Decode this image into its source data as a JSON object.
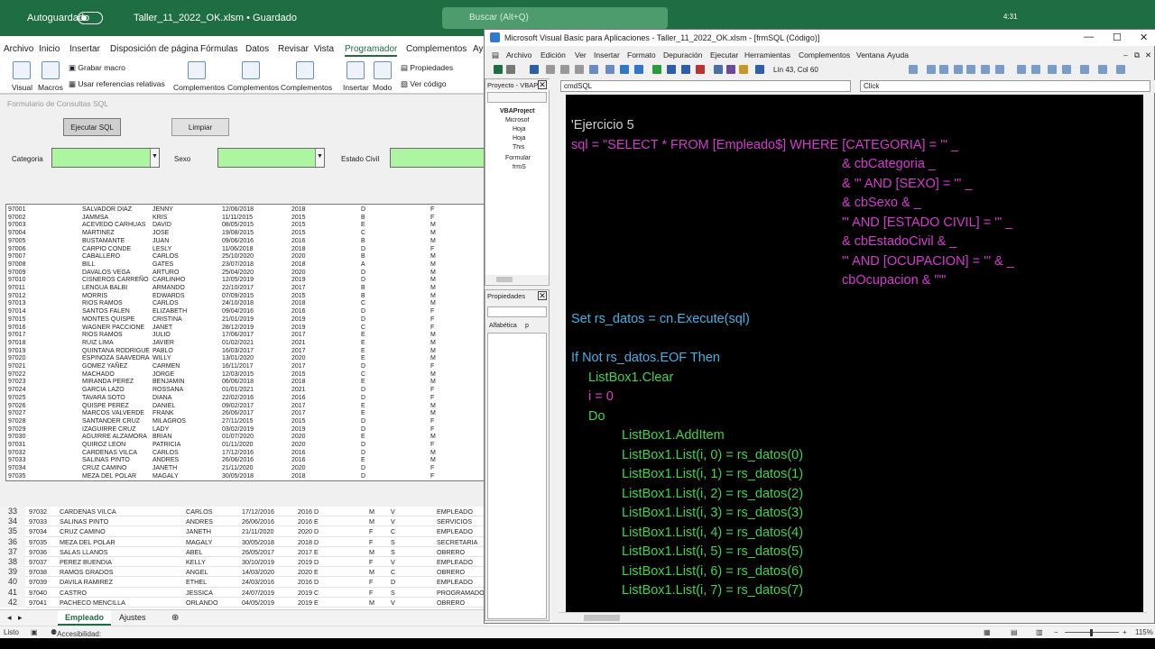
{
  "excel": {
    "autosave_label": "Autoguardado",
    "file_title": "Taller_11_2022_OK.xlsm • Guardado",
    "search_placeholder": "Buscar (Alt+Q)",
    "menu": [
      "Archivo",
      "Inicio",
      "Insertar",
      "Disposición de página",
      "Fórmulas",
      "Datos",
      "Revisar",
      "Vista",
      "Programador",
      "Complementos",
      "Ay"
    ],
    "ribbon": {
      "visual": "Visual",
      "macros": "Macros",
      "grabar": "Grabar macro",
      "refs": "Usar referencias relativas",
      "comp1": "Complementos",
      "comp2": "Complementos",
      "comp3": "Complementos",
      "insertar": "Insertar",
      "modo": "Modo",
      "propiedades": "Propiedades",
      "vercodigo": "Ver código"
    },
    "form": {
      "title": "Formulario de Consultas SQL",
      "btn_execute": "Ejecutar SQL",
      "btn_clear": "Limpiar",
      "label_categoria": "Categoria",
      "label_sexo": "Sexo",
      "label_estado": "Estado Civil",
      "rows": [
        [
          "97001",
          "SALVADOR DIAZ",
          "JENNY",
          "12/06/2018",
          "2018",
          "D",
          "F"
        ],
        [
          "97002",
          "JAMMSA",
          "KRIS",
          "11/11/2015",
          "2015",
          "B",
          "F"
        ],
        [
          "97003",
          "ACEVEDO CARHUAS",
          "DAVID",
          "08/05/2015",
          "2015",
          "E",
          "M"
        ],
        [
          "97004",
          "MARTINEZ",
          "JOSE",
          "19/08/2015",
          "2015",
          "C",
          "M"
        ],
        [
          "97005",
          "BUSTAMANTE",
          "JUAN",
          "09/06/2016",
          "2016",
          "B",
          "M"
        ],
        [
          "97006",
          "CARPIO CONDE",
          "LESLY",
          "11/06/2018",
          "2018",
          "D",
          "F"
        ],
        [
          "97007",
          "CABALLERO",
          "CARLOS",
          "25/10/2020",
          "2020",
          "B",
          "M"
        ],
        [
          "97008",
          "BILL",
          "GATES",
          "23/07/2018",
          "2018",
          "A",
          "M"
        ],
        [
          "97009",
          "DAVALOS VEGA",
          "ARTURO",
          "25/04/2020",
          "2020",
          "D",
          "M"
        ],
        [
          "97010",
          "CISNEROS CARREÑO",
          "CARLINHO",
          "12/05/2019",
          "2019",
          "D",
          "M"
        ],
        [
          "97011",
          "LENGUA BALBI",
          "ARMANDO",
          "22/10/2017",
          "2017",
          "B",
          "M"
        ],
        [
          "97012",
          "MORRIS",
          "EDWARDS",
          "07/09/2015",
          "2015",
          "B",
          "M"
        ],
        [
          "97013",
          "RIOS RAMOS",
          "CARLOS",
          "24/10/2018",
          "2018",
          "C",
          "M"
        ],
        [
          "97014",
          "SANTOS FALEN",
          "ELIZABETH",
          "09/04/2016",
          "2016",
          "D",
          "F"
        ],
        [
          "97015",
          "MONTES QUISPE",
          "CRISTINA",
          "21/01/2019",
          "2019",
          "D",
          "F"
        ],
        [
          "97016",
          "WAGNER PACCIONE",
          "JANET",
          "28/12/2019",
          "2019",
          "C",
          "F"
        ],
        [
          "97017",
          "RIOS RAMOS",
          "JULIO",
          "17/06/2017",
          "2017",
          "E",
          "M"
        ],
        [
          "97018",
          "RUIZ LIMA",
          "JAVIER",
          "01/02/2021",
          "2021",
          "E",
          "M"
        ],
        [
          "97019",
          "QUINTANA RODRIGUE",
          "PABLO",
          "16/03/2017",
          "2017",
          "E",
          "M"
        ],
        [
          "97020",
          "ESPINOZA SAAVEDRA",
          "WILLY",
          "13/01/2020",
          "2020",
          "E",
          "M"
        ],
        [
          "97021",
          "GOMEZ YAÑEZ",
          "CARMEN",
          "16/11/2017",
          "2017",
          "D",
          "F"
        ],
        [
          "97022",
          "MACHADO",
          "JORGE",
          "12/03/2015",
          "2015",
          "C",
          "M"
        ],
        [
          "97023",
          "MIRANDA PEREZ",
          "BENJAMIN",
          "06/06/2018",
          "2018",
          "E",
          "M"
        ],
        [
          "97024",
          "GARCIA LAZO",
          "ROSSANA",
          "01/01/2021",
          "2021",
          "D",
          "F"
        ],
        [
          "97025",
          "TAVARA SOTO",
          "DIANA",
          "22/02/2016",
          "2016",
          "D",
          "F"
        ],
        [
          "97026",
          "QUISPE PEREZ",
          "DANIEL",
          "09/02/2017",
          "2017",
          "E",
          "M"
        ],
        [
          "97027",
          "MARCOS VALVERDE",
          "FRANK",
          "26/06/2017",
          "2017",
          "E",
          "M"
        ],
        [
          "97028",
          "SANTANDER CRUZ",
          "MILAGROS",
          "27/11/2015",
          "2015",
          "D",
          "F"
        ],
        [
          "97029",
          "IZAGUIRRE CRUZ",
          "LADY",
          "03/02/2019",
          "2019",
          "D",
          "F"
        ],
        [
          "97030",
          "AGUIRRE ALZAMORA",
          "BRIAN",
          "01/07/2020",
          "2020",
          "E",
          "M"
        ],
        [
          "97031",
          "QUIROZ LEON",
          "PATRICIA",
          "01/11/2020",
          "2020",
          "D",
          "F"
        ],
        [
          "97032",
          "CARDENAS VILCA",
          "CARLOS",
          "17/12/2016",
          "2016",
          "D",
          "M"
        ],
        [
          "97033",
          "SALINAS PINTO",
          "ANDRES",
          "26/06/2016",
          "2016",
          "E",
          "M"
        ],
        [
          "97034",
          "CRUZ CAMINO",
          "JANETH",
          "21/11/2020",
          "2020",
          "D",
          "F"
        ],
        [
          "97035",
          "MEZA DEL POLAR",
          "MAGALY",
          "30/05/2018",
          "2018",
          "D",
          "F"
        ]
      ]
    },
    "sheet_rows": [
      [
        "33",
        "97032",
        "CARDENAS VILCA",
        "CARLOS",
        "17/12/2016",
        "2016 D",
        "M",
        "V",
        "EMPLEADO"
      ],
      [
        "34",
        "97033",
        "SALINAS PINTO",
        "ANDRES",
        "26/06/2016",
        "2016 E",
        "M",
        "V",
        "SERVICIOS"
      ],
      [
        "35",
        "97034",
        "CRUZ CAMINO",
        "JANETH",
        "21/11/2020",
        "2020 D",
        "F",
        "C",
        "EMPLEADO"
      ],
      [
        "36",
        "97035",
        "MEZA DEL POLAR",
        "MAGALY",
        "30/05/2018",
        "2018 D",
        "F",
        "S",
        "SECRETARIA"
      ],
      [
        "37",
        "97036",
        "SALAS LLANOS",
        "ABEL",
        "26/05/2017",
        "2017 E",
        "M",
        "S",
        "OBRERO"
      ],
      [
        "38",
        "97037",
        "PEREZ BUENDIA",
        "KELLY",
        "30/10/2019",
        "2019 D",
        "F",
        "V",
        "EMPLEADO"
      ],
      [
        "39",
        "97038",
        "RAMOS GRADOS",
        "ANGEL",
        "14/03/2020",
        "2020 E",
        "M",
        "C",
        "OBRERO"
      ],
      [
        "40",
        "97039",
        "DAVILA RAMIREZ",
        "ETHEL",
        "24/03/2016",
        "2016 D",
        "F",
        "D",
        "EMPLEADO"
      ],
      [
        "41",
        "97040",
        "CASTRO",
        "JESSICA",
        "24/07/2019",
        "2019 C",
        "F",
        "S",
        "PROGRAMADO"
      ],
      [
        "42",
        "97041",
        "PACHECO MENCILLA",
        "ORLANDO",
        "04/05/2019",
        "2019 E",
        "M",
        "V",
        "OBRERO"
      ]
    ],
    "tabs": [
      "Empleado",
      "Ajustes"
    ],
    "status_listo": "Listo",
    "status_access": "Accesibilidad: todo correcto",
    "zoom": "115%",
    "clock": "4:31"
  },
  "vbe": {
    "title": "Microsoft Visual Basic para Aplicaciones - Taller_11_2022_OK.xlsm - [frmSQL (Código)]",
    "menu": [
      "Archivo",
      "Edición",
      "Ver",
      "Insertar",
      "Formato",
      "Depuración",
      "Ejecutar",
      "Herramientas",
      "Complementos",
      "Ventana",
      "Ayuda"
    ],
    "position": "Lín 43, Col 60",
    "project_title": "Proyecto - VBAP",
    "tree": [
      "VBAProject",
      "Microsof",
      "Hoja",
      "Hoja",
      "This",
      "Formular",
      "frmS"
    ],
    "props_title": "Propiedades",
    "props_tabs": [
      "Alfabética",
      "p"
    ],
    "object_dd": "cmdSQL",
    "proc_dd": "Click",
    "code": [
      {
        "cls": "c-com",
        "text": "'Ejercicio 5"
      },
      {
        "cls": "c-str",
        "text": "sql = \"SELECT * FROM [Empleado$] WHERE [CATEGORIA] = '\" _"
      },
      {
        "cls": "c-str",
        "text": "& cbCategoria _",
        "indent": 1
      },
      {
        "cls": "c-str",
        "text": "& \"' AND [SEXO] = '\" _",
        "indent": 1
      },
      {
        "cls": "c-str",
        "text": "& cbSexo & _",
        "indent": 1
      },
      {
        "cls": "c-str",
        "text": "\"' AND [ESTADO CIVIL] = '\" _",
        "indent": 1
      },
      {
        "cls": "c-str",
        "text": "& cbEstadoCivil & _",
        "indent": 1
      },
      {
        "cls": "c-str",
        "text": "\"' AND [OCUPACION] = '\" & _",
        "indent": 1
      },
      {
        "cls": "c-str",
        "text": "cbOcupacion & \"'\"",
        "indent": 1
      },
      {
        "cls": "c-pl",
        "text": ""
      },
      {
        "cls": "c-kw",
        "text": "Set rs_datos = cn.Execute(sql)"
      },
      {
        "cls": "c-pl",
        "text": ""
      },
      {
        "cls": "c-kw",
        "text": "If Not rs_datos.EOF Then"
      },
      {
        "cls": "c-gr",
        "text": "ListBox1.Clear",
        "indent": 2
      },
      {
        "cls": "c-id",
        "text": "i = 0",
        "indent": 2
      },
      {
        "cls": "c-gr",
        "text": "Do",
        "indent": 2
      },
      {
        "cls": "c-gr",
        "text": "ListBox1.AddItem",
        "indent": 3
      },
      {
        "cls": "c-gr",
        "text": "ListBox1.List(i, 0) = rs_datos(0)",
        "indent": 3
      },
      {
        "cls": "c-gr",
        "text": "ListBox1.List(i, 1) = rs_datos(1)",
        "indent": 3
      },
      {
        "cls": "c-gr",
        "text": "ListBox1.List(i, 2) = rs_datos(2)",
        "indent": 3
      },
      {
        "cls": "c-gr",
        "text": "ListBox1.List(i, 3) = rs_datos(3)",
        "indent": 3
      },
      {
        "cls": "c-gr",
        "text": "ListBox1.List(i, 4) = rs_datos(4)",
        "indent": 3
      },
      {
        "cls": "c-gr",
        "text": "ListBox1.List(i, 5) = rs_datos(5)",
        "indent": 3
      },
      {
        "cls": "c-gr",
        "text": "ListBox1.List(i, 6) = rs_datos(6)",
        "indent": 3
      },
      {
        "cls": "c-gr",
        "text": "ListBox1.List(i, 7) = rs_datos(7)",
        "indent": 3
      }
    ]
  },
  "colors": {
    "excel_green": "#1f6e43",
    "combo_fill": "#aef5a1",
    "code_bg": "#000000"
  }
}
